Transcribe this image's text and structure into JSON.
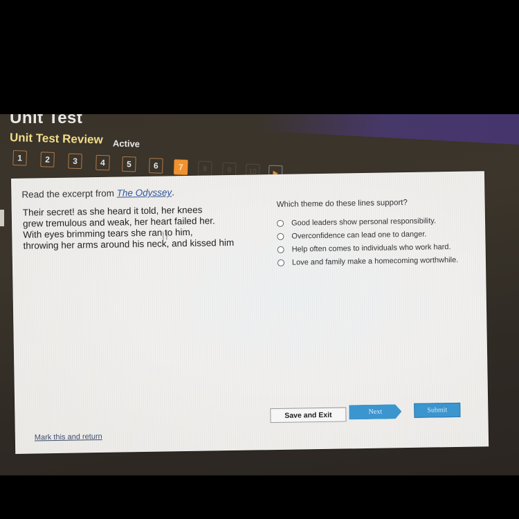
{
  "header": {
    "title": "Unit Test",
    "subtitle": "Unit Test Review",
    "status": "Active"
  },
  "navigation": {
    "questions": [
      {
        "label": "1",
        "state": "answered"
      },
      {
        "label": "2",
        "state": "answered"
      },
      {
        "label": "3",
        "state": "answered"
      },
      {
        "label": "4",
        "state": "answered"
      },
      {
        "label": "5",
        "state": "answered"
      },
      {
        "label": "6",
        "state": "answered"
      },
      {
        "label": "7",
        "state": "current"
      },
      {
        "label": "8",
        "state": "locked"
      },
      {
        "label": "9",
        "state": "locked"
      },
      {
        "label": "10",
        "state": "locked"
      }
    ],
    "next_arrow": "▶",
    "current_question": 7,
    "total_questions": 10
  },
  "colors": {
    "accent": "#f0922e",
    "subtitle": "#f1dd8c",
    "button_blue": "#3b95cf",
    "link": "#31569a"
  },
  "question": {
    "prompt_prefix": "Read the excerpt from ",
    "source_title": "The Odyssey",
    "prompt_suffix": ".",
    "excerpt_lines": [
      "Their secret! as she heard it told, her knees",
      "grew tremulous and weak, her heart failed her.",
      "With eyes brimming tears she ran to him,",
      "throwing her arms around his neck, and kissed him"
    ],
    "stem": "Which theme do these lines support?",
    "options": [
      "Good leaders show personal responsibility.",
      "Overconfidence can lead one to danger.",
      "Help often comes to individuals who work hard.",
      "Love and family make a homecoming worthwhile."
    ]
  },
  "actions": {
    "save_exit": "Save and Exit",
    "next": "Next",
    "submit": "Submit",
    "mark_return": "Mark this and return"
  },
  "icons": {
    "print": "print-icon"
  }
}
